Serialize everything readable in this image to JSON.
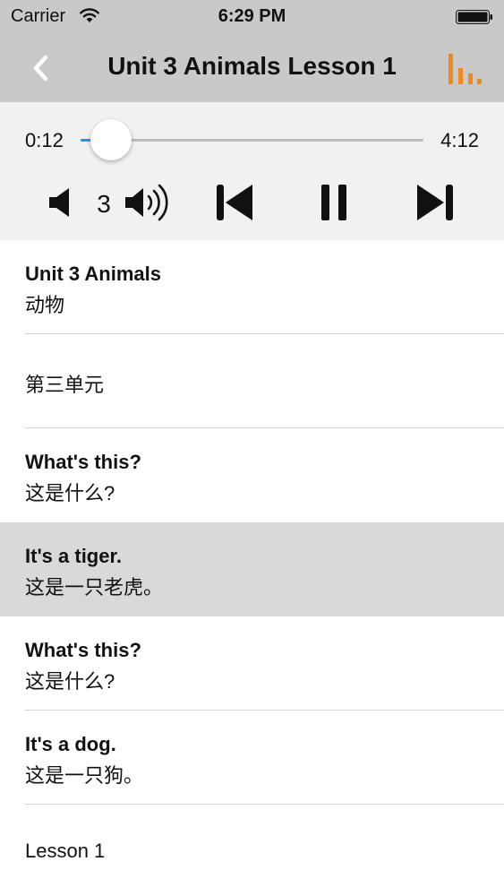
{
  "status_bar": {
    "carrier": "Carrier",
    "time": "6:29 PM",
    "wifi_icon": "wifi-icon",
    "battery_icon": "battery-icon"
  },
  "nav": {
    "title": "Unit 3 Animals Lesson 1",
    "back_icon": "chevron-left-icon",
    "equalizer_icon": "equalizer-icon",
    "accent_color": "#f0891e"
  },
  "player": {
    "current_time": "0:12",
    "total_time": "4:12",
    "progress": 0.048,
    "volume_level": "3",
    "progress_color": "#1f9ad6"
  },
  "lines": [
    {
      "english": "Unit 3 Animals",
      "chinese": "动物",
      "selected": false
    },
    {
      "single": "第三单元",
      "selected": false
    },
    {
      "english": "What's this?",
      "chinese": "这是什么?",
      "selected": false
    },
    {
      "english": "It's a tiger.",
      "chinese": "这是一只老虎。",
      "selected": true
    },
    {
      "english": "What's this?",
      "chinese": "这是什么?",
      "selected": false
    },
    {
      "english": "It's a dog.",
      "chinese": "这是一只狗。",
      "selected": false
    },
    {
      "single": "Lesson 1",
      "selected": false
    }
  ]
}
